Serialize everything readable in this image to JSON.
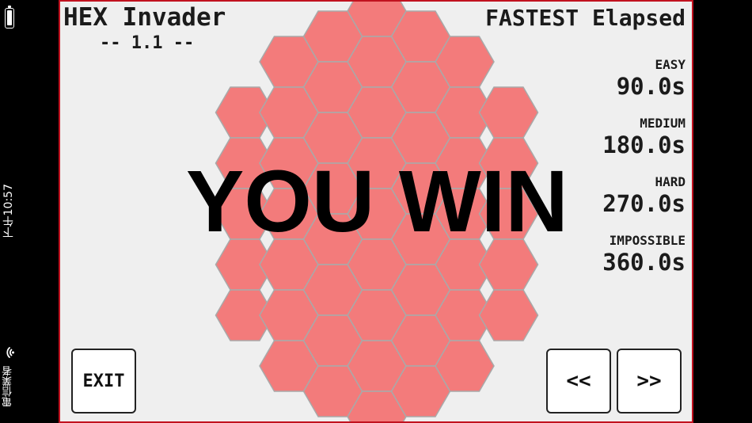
{
  "status_bar": {
    "time": "下午10:57",
    "carrier": "電信業者",
    "battery_icon": "battery-icon",
    "wifi_icon": "wifi-icon"
  },
  "game": {
    "title": "HEX Invader",
    "version": "-- 1.1 --",
    "result": "YOU WIN",
    "colors": {
      "background": "#efefef",
      "hex_fill": "#f37b7b",
      "hex_stroke": "#a9a9a9",
      "border": "#c1121f"
    }
  },
  "scores": {
    "title": "FASTEST Elapsed",
    "entries": [
      {
        "label": "EASY",
        "value": "90.0s"
      },
      {
        "label": "MEDIUM",
        "value": "180.0s"
      },
      {
        "label": "HARD",
        "value": "270.0s"
      },
      {
        "label": "IMPOSSIBLE",
        "value": "360.0s"
      }
    ]
  },
  "buttons": {
    "exit": "EXIT",
    "prev": "<<",
    "next": ">>"
  }
}
